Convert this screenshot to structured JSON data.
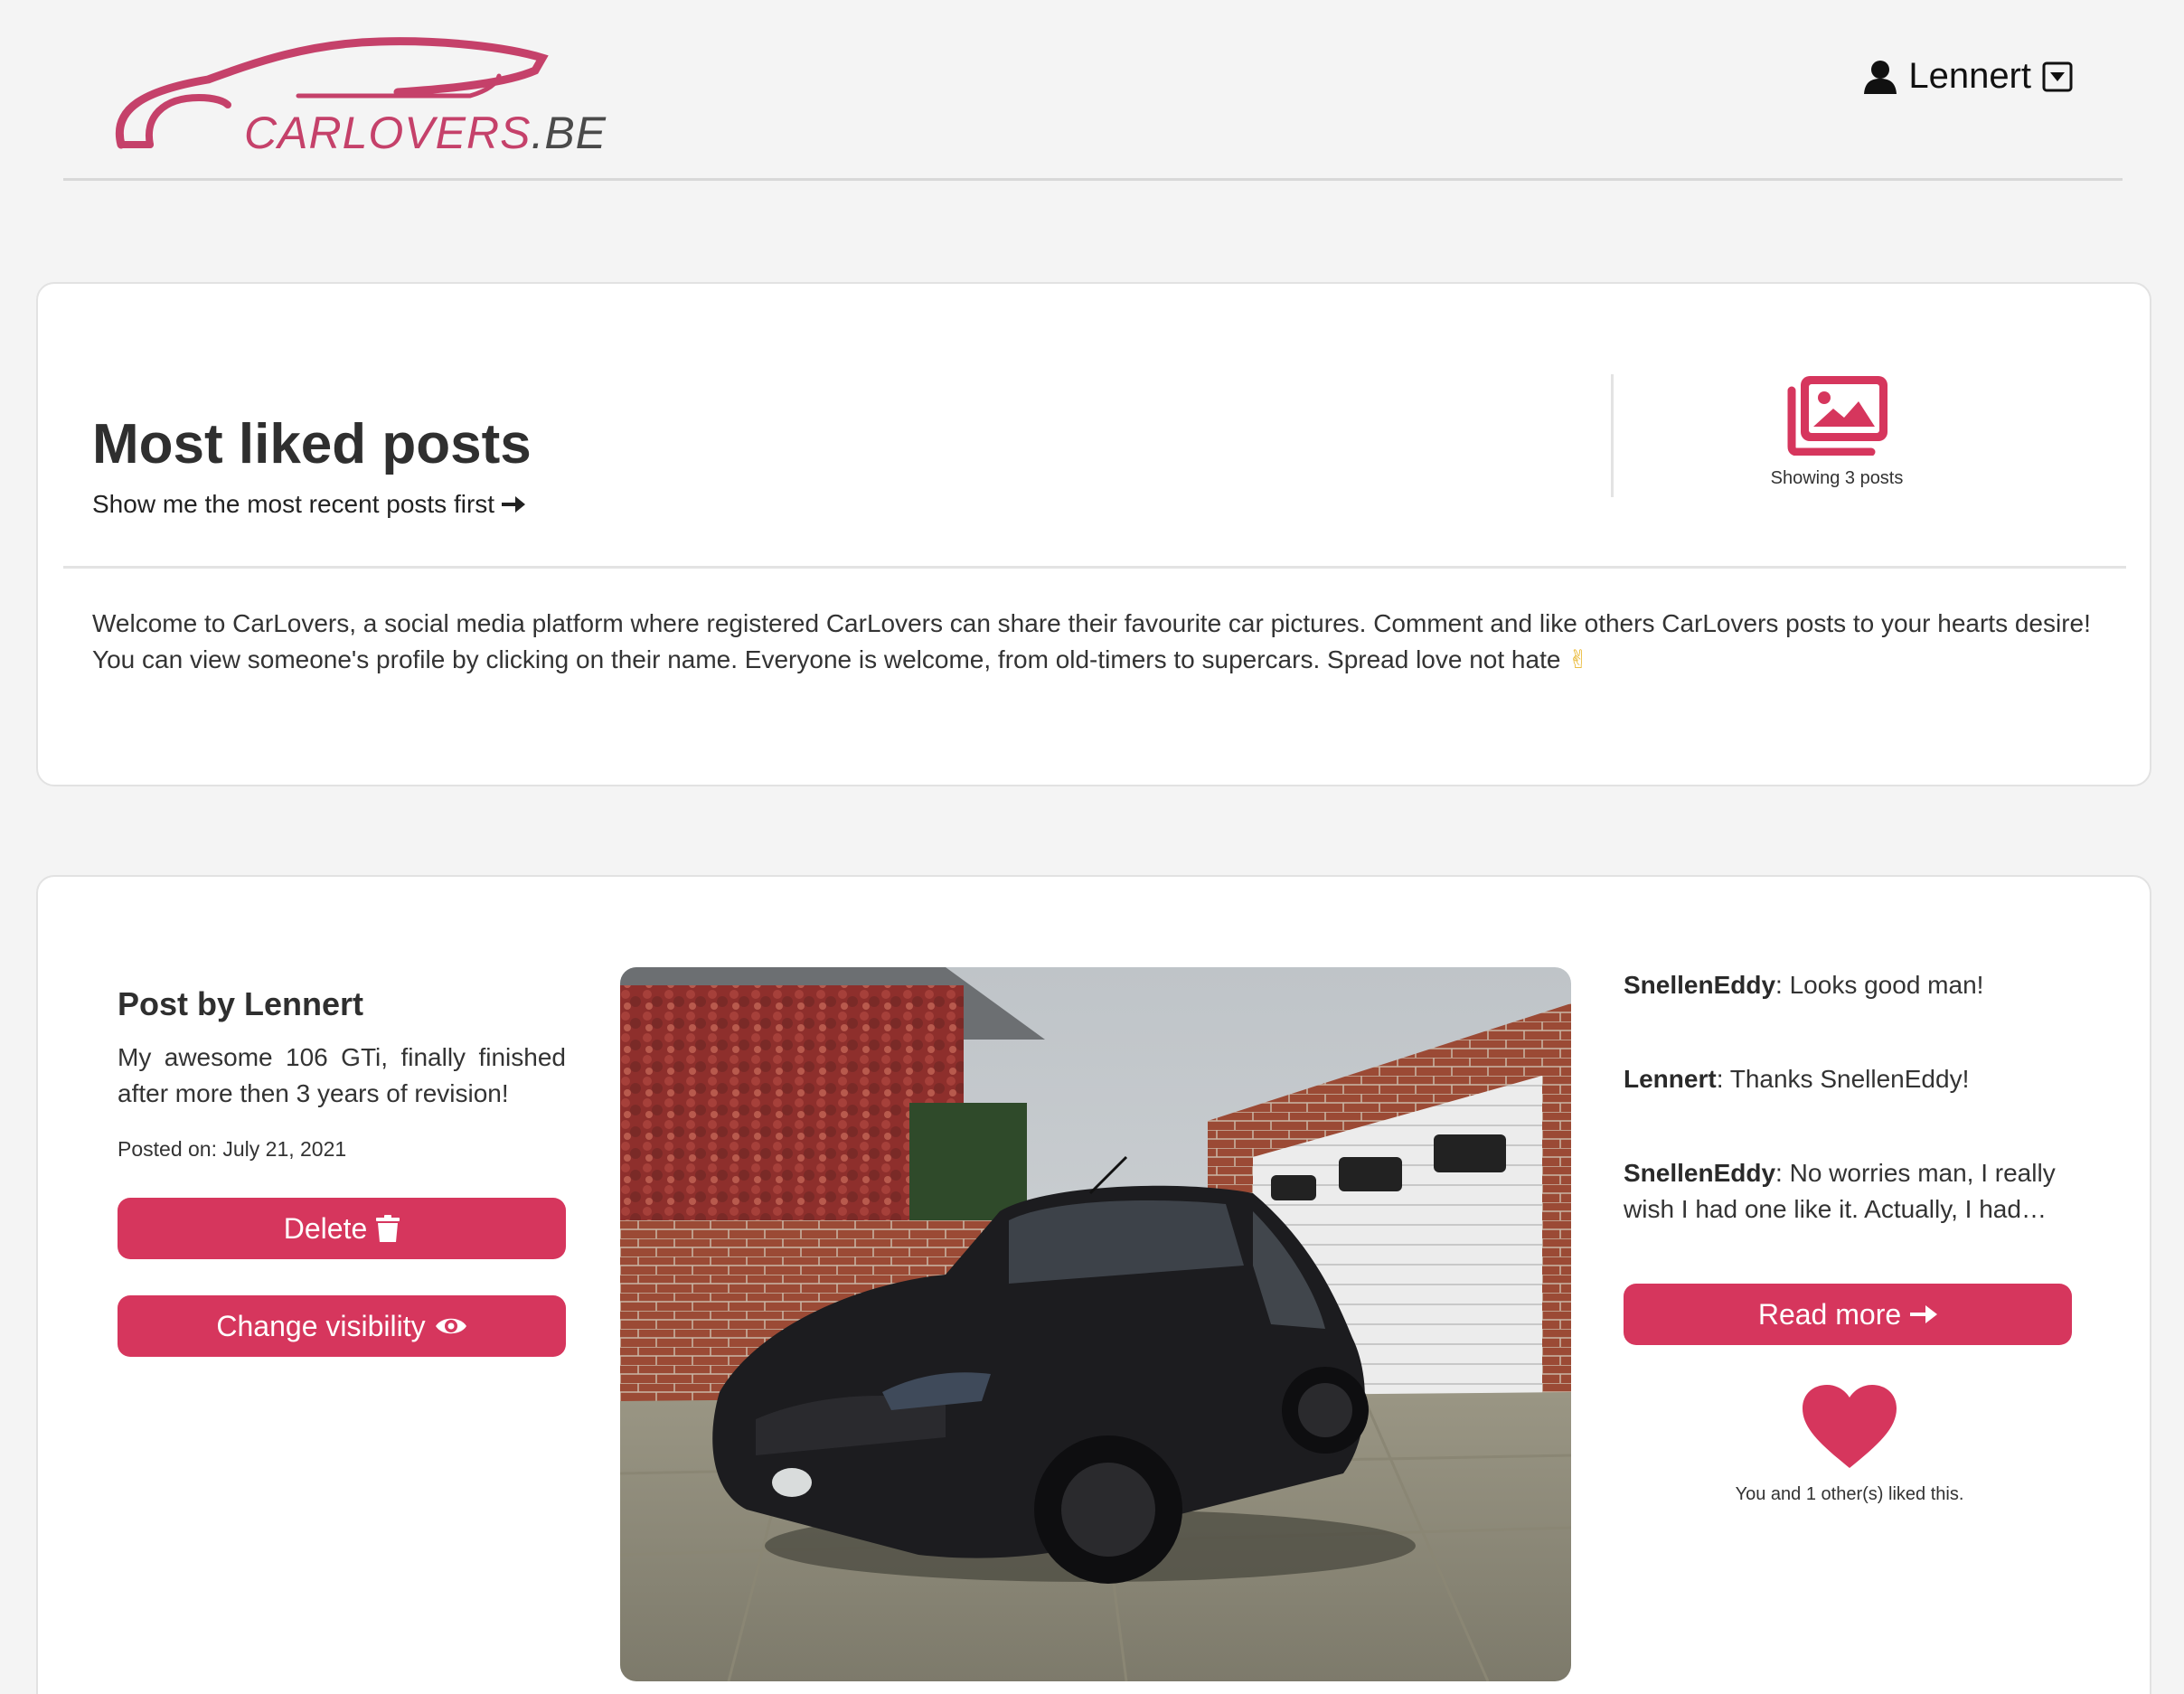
{
  "header": {
    "logo_brand": "CARLOVERS",
    "logo_tld": ".BE",
    "username": "Lennert"
  },
  "intro": {
    "title": "Most liked posts",
    "sort_link": "Show me the most recent posts first",
    "posts_count_label": "Showing 3 posts",
    "welcome_text": "Welcome to CarLovers, a social media platform where registered CarLovers can share their favourite car pictures. Comment and like others CarLovers posts to your hearts desire! You can view someone's profile by clicking on their name. Everyone is welcome, from old-timers to supercars. Spread love not hate",
    "welcome_emoji": "✌"
  },
  "post": {
    "author_label": "Post by Lennert",
    "caption": "My awesome 106 GTi, finally finished after more then 3 years of revision!",
    "date": "Posted on: July 21, 2021",
    "delete_label": "Delete",
    "visibility_label": "Change visibility",
    "comments": [
      {
        "user": "SnellenEddy",
        "text": ": Looks good man!"
      },
      {
        "user": "Lennert",
        "text": ": Thanks SnellenEddy!"
      },
      {
        "user": "SnellenEddy",
        "text": ": No worries man, I really wish I had one like it. Actually, I had…"
      }
    ],
    "read_more_label": "Read more",
    "likes_label": "You and 1 other(s) liked this."
  },
  "colors": {
    "accent": "#d6365d",
    "logo": "#c5416a"
  }
}
